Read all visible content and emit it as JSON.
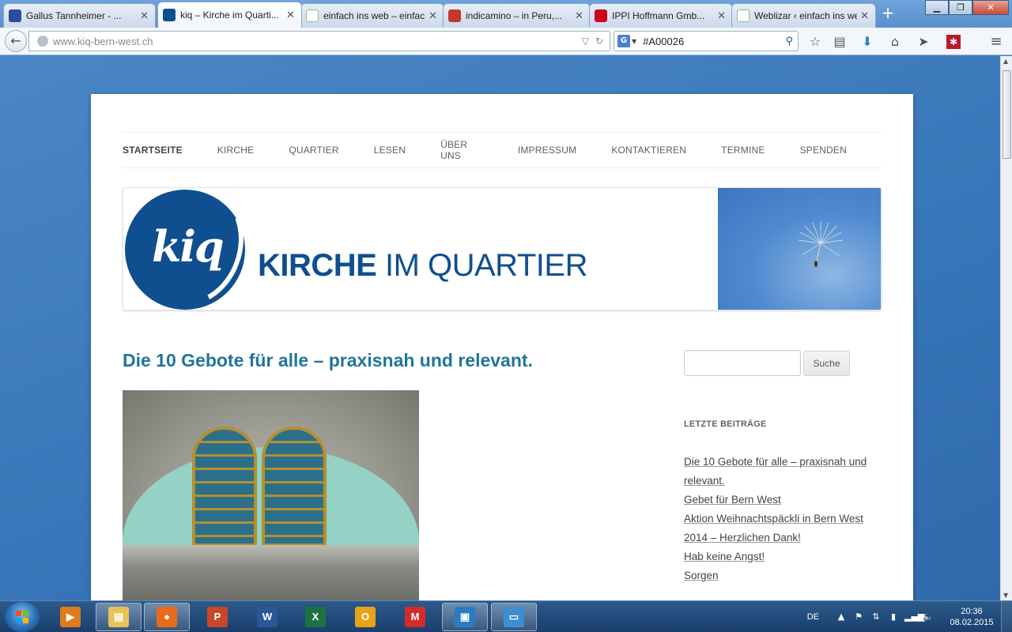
{
  "browser": {
    "tabs": [
      {
        "label": "Gallus Tannheimer - ...",
        "active": false,
        "favicon_color": "#2b4d9e",
        "favicon": "star-icon"
      },
      {
        "label": "kiq – Kirche im Quarti...",
        "active": true,
        "favicon_color": "#0f4f8f",
        "favicon": "kiq-logo-icon"
      },
      {
        "label": "einfach ins web – einfach ...",
        "active": false,
        "favicon_color": "#ffffff",
        "favicon": "blank-page-icon"
      },
      {
        "label": "indicamino – in Peru,...",
        "active": false,
        "favicon_color": "#c0392b",
        "favicon": "indicamino-icon"
      },
      {
        "label": "IPPI Hoffmann Gmb...",
        "active": false,
        "favicon_color": "#d0021b",
        "favicon": "ippi-icon"
      },
      {
        "label": "Weblizar ‹ einfach ins we...",
        "active": false,
        "favicon_color": "#ffffff",
        "favicon": "blank-page-icon"
      }
    ],
    "url": "www.kiq-bern-west.ch",
    "search_value": "#A00026",
    "search_engine": "G"
  },
  "site": {
    "menu": [
      {
        "label": "STARTSEITE",
        "current": true
      },
      {
        "label": "KIRCHE",
        "current": false
      },
      {
        "label": "QUARTIER",
        "current": false
      },
      {
        "label": "LESEN",
        "current": false
      },
      {
        "label": "ÜBER UNS",
        "current": false
      },
      {
        "label": "IMPRESSUM",
        "current": false
      },
      {
        "label": "KONTAKTIEREN",
        "current": false
      },
      {
        "label": "TERMINE",
        "current": false
      },
      {
        "label": "SPENDEN",
        "current": false
      }
    ],
    "logo": {
      "mark": "kiq",
      "title_bold": "KIRCHE",
      "title_light": " IM QUARTIER"
    },
    "post_title": "Die 10 Gebote für alle – praxisnah und relevant.",
    "sidebar": {
      "search_button": "Suche",
      "widget_title": "LETZTE BEITRÄGE",
      "recent_posts": [
        {
          "lines": [
            "Die 10 Gebote für alle – praxisnah und",
            "relevant."
          ]
        },
        {
          "lines": [
            "Gebet für Bern West"
          ]
        },
        {
          "lines": [
            "Aktion Weihnachtspäckli in Bern West",
            "2014 – Herzlichen Dank!"
          ]
        },
        {
          "lines": [
            "Hab keine Angst!"
          ]
        },
        {
          "lines": [
            "Sorgen"
          ]
        }
      ]
    }
  },
  "taskbar": {
    "apps": [
      {
        "name": "media-player",
        "glyph": "▶",
        "color": "#e07a1c",
        "open": false
      },
      {
        "name": "file-explorer",
        "glyph": "▤",
        "color": "#e8c35a",
        "open": true
      },
      {
        "name": "firefox",
        "glyph": "●",
        "color": "#e76b1b",
        "open": true
      },
      {
        "name": "powerpoint",
        "glyph": "P",
        "color": "#c8472a",
        "open": false
      },
      {
        "name": "word",
        "glyph": "W",
        "color": "#2b5797",
        "open": false
      },
      {
        "name": "excel",
        "glyph": "X",
        "color": "#1e7145",
        "open": false
      },
      {
        "name": "outlook",
        "glyph": "O",
        "color": "#e8a317",
        "open": false
      },
      {
        "name": "mindmanager",
        "glyph": "M",
        "color": "#d42a2a",
        "open": false
      },
      {
        "name": "app-window",
        "glyph": "▣",
        "color": "#2b7bc4",
        "open": true
      },
      {
        "name": "photo-viewer",
        "glyph": "▭",
        "color": "#3b8fd0",
        "open": true
      }
    ],
    "language": "DE",
    "time": "20:36",
    "date": "08.02.2015"
  }
}
